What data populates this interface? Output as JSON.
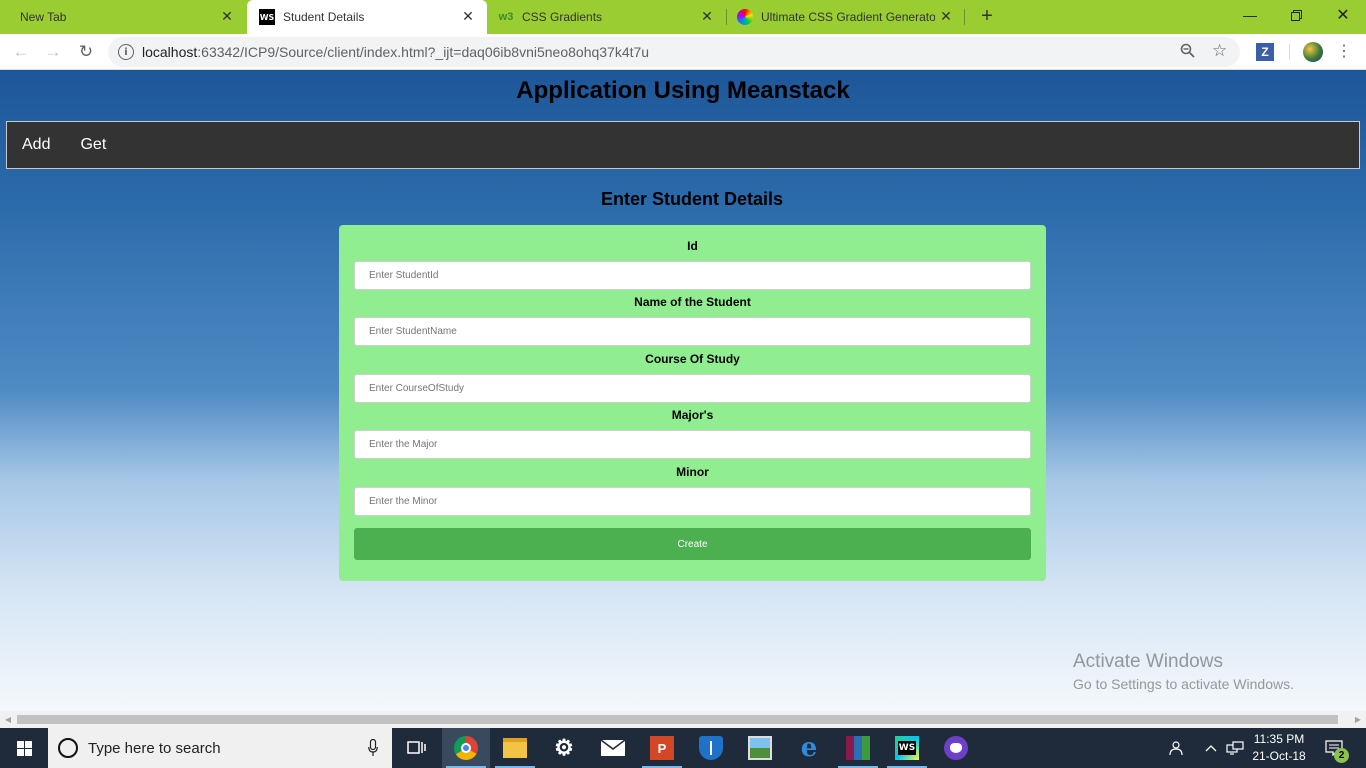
{
  "browser": {
    "tabs": [
      {
        "title": "New Tab",
        "active": false
      },
      {
        "title": "Student Details",
        "active": true,
        "favicon": "ws-icon"
      },
      {
        "title": "CSS Gradients",
        "active": false,
        "favicon": "w3-icon"
      },
      {
        "title": "Ultimate CSS Gradient Generator",
        "active": false,
        "favicon": "gradient-icon"
      }
    ],
    "new_tab_label": "+",
    "url_host": "localhost",
    "url_rest": ":63342/ICP9/Source/client/index.html?_ijt=daq06ib8vni5neo8ohq37k4t7u",
    "extension_label": "Z",
    "accent_color": "#9acd32"
  },
  "page": {
    "app_title": "Application Using Meanstack",
    "nav": [
      {
        "label": "Add"
      },
      {
        "label": "Get"
      }
    ],
    "section_title": "Enter Student Details",
    "form": {
      "fields": [
        {
          "label": "Id",
          "placeholder": "Enter StudentId",
          "value": ""
        },
        {
          "label": "Name of the Student",
          "placeholder": "Enter StudentName",
          "value": ""
        },
        {
          "label": "Course Of Study",
          "placeholder": "Enter CourseOfStudy",
          "value": ""
        },
        {
          "label": "Major's",
          "placeholder": "Enter the Major",
          "value": ""
        },
        {
          "label": "Minor",
          "placeholder": "Enter the Minor",
          "value": ""
        }
      ],
      "submit_label": "Create",
      "card_color": "#90ee90",
      "button_color": "#4caf50"
    },
    "watermark": {
      "title": "Activate Windows",
      "subtitle": "Go to Settings to activate Windows."
    }
  },
  "taskbar": {
    "search_placeholder": "Type here to search",
    "time": "11:35 PM",
    "date": "21-Oct-18",
    "notification_count": "2",
    "apps": [
      "task-view-icon",
      "chrome-icon",
      "file-explorer-icon",
      "settings-icon",
      "mail-icon",
      "powerpoint-icon",
      "defender-icon",
      "photos-icon",
      "edge-icon",
      "winrar-icon",
      "webstorm-icon",
      "github-desktop-icon"
    ]
  }
}
